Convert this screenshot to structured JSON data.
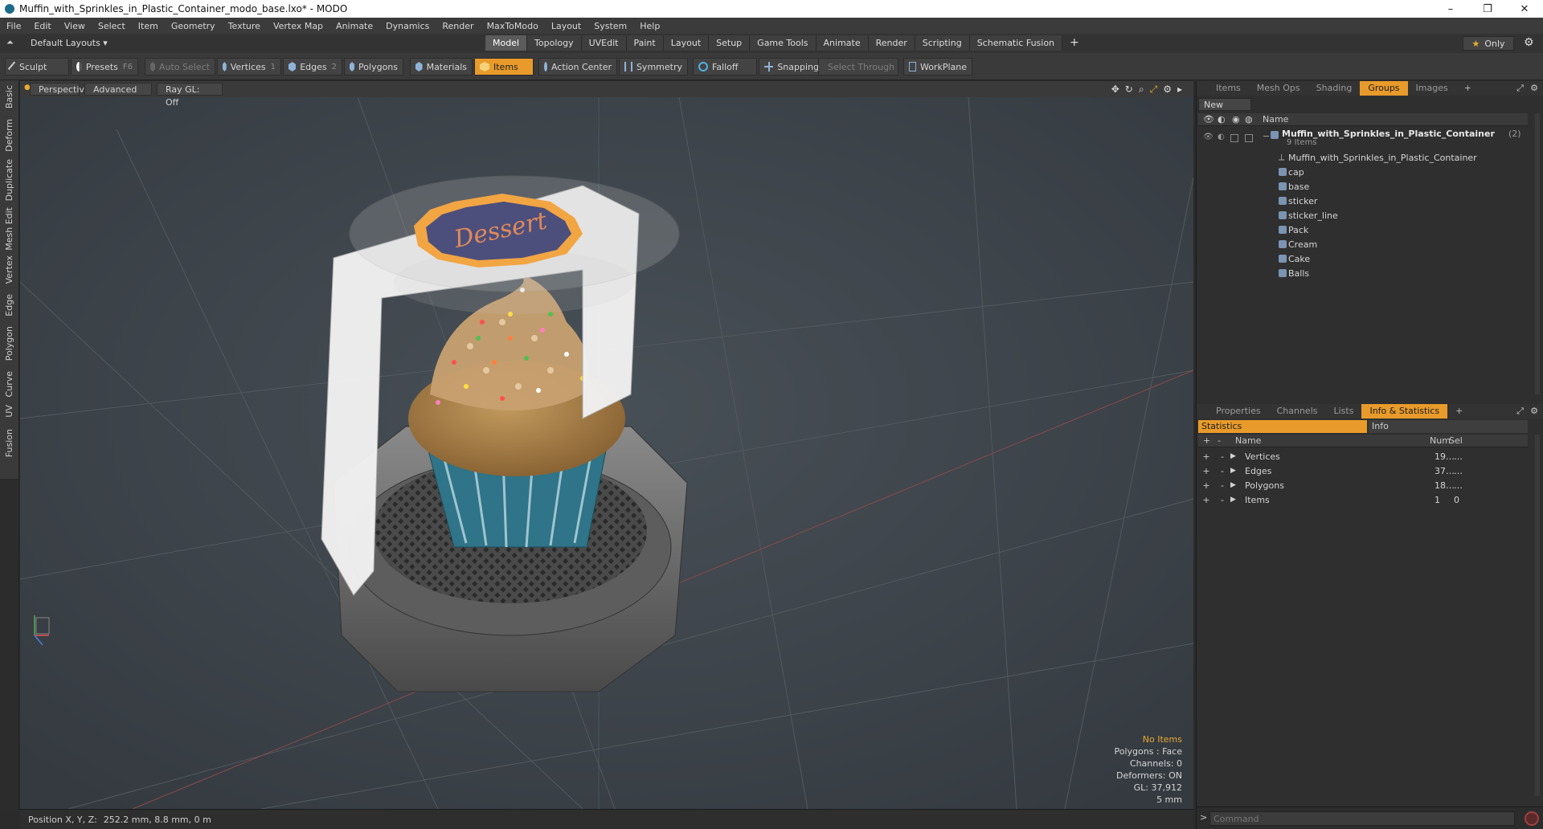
{
  "window": {
    "title": "Muffin_with_Sprinkles_in_Plastic_Container_modo_base.lxo* - MODO",
    "controls": [
      "–",
      "❐",
      "✕"
    ]
  },
  "menu": [
    "File",
    "Edit",
    "View",
    "Select",
    "Item",
    "Geometry",
    "Texture",
    "Vertex Map",
    "Animate",
    "Dynamics",
    "Render",
    "MaxToModo",
    "Layout",
    "System",
    "Help"
  ],
  "layoutbar": {
    "layout_name": "Default Layouts ▾",
    "tabs": [
      "Model",
      "Topology",
      "UVEdit",
      "Paint",
      "Layout",
      "Setup",
      "Game Tools",
      "Animate",
      "Render",
      "Scripting",
      "Schematic Fusion"
    ],
    "active_tab": "Model",
    "add": "+",
    "only_label": "Only"
  },
  "toolbar": {
    "sculpt": "Sculpt",
    "presets": "Presets",
    "presets_key": "F6",
    "auto_select": "Auto Select",
    "vertices": "Vertices",
    "vertices_num": "1",
    "edges": "Edges",
    "edges_num": "2",
    "polygons": "Polygons",
    "materials": "Materials",
    "items": "Items",
    "action_center": "Action Center",
    "symmetry": "Symmetry",
    "falloff": "Falloff",
    "snapping": "Snapping",
    "select_through": "Select Through",
    "workplane": "WorkPlane"
  },
  "left_tabs": [
    "Basic",
    "Deform",
    "Duplicate",
    "Mesh Edit",
    "Vertex",
    "Edge",
    "Polygon",
    "Curve",
    "UV",
    "Fusion"
  ],
  "viewport": {
    "perspective": "Perspective",
    "advanced": "Advanced",
    "raygl": "Ray GL: Off",
    "sticker_text": "Dessert",
    "hud": {
      "no_items": "No Items",
      "polygons": "Polygons : Face",
      "channels": "Channels: 0",
      "deformers": "Deformers: ON",
      "gl": "GL: 37,912",
      "scale": "5 mm"
    }
  },
  "status": {
    "label": "Position X, Y, Z:",
    "value": "252.2 mm, 8.8 mm, 0 m"
  },
  "items_panel": {
    "tabs": [
      "Items",
      "Mesh Ops",
      "Shading",
      "Groups",
      "Images"
    ],
    "active_tab": "Groups",
    "new_group": "New Group",
    "col_name": "Name",
    "group_name": "Muffin_with_Sprinkles_in_Plastic_Container",
    "group_count": "(2)",
    "group_sub": "9 Items",
    "items": [
      "Muffin_with_Sprinkles_in_Plastic_Container",
      "cap",
      "base",
      "sticker",
      "sticker_line",
      "Pack",
      "Cream",
      "Cake",
      "Balls"
    ]
  },
  "stats_panel": {
    "tabs": [
      "Properties",
      "Channels",
      "Lists",
      "Info & Statistics"
    ],
    "active_tab": "Info & Statistics",
    "sub_tabs": [
      "Statistics",
      "Info"
    ],
    "cols": [
      "Name",
      "Num",
      "Sel"
    ],
    "rows": [
      {
        "name": "Vertices",
        "num": "19…",
        "sel": "…"
      },
      {
        "name": "Edges",
        "num": "37…",
        "sel": "…"
      },
      {
        "name": "Polygons",
        "num": "18…",
        "sel": "…"
      },
      {
        "name": "Items",
        "num": "1",
        "sel": "0"
      }
    ]
  },
  "command": {
    "placeholder": "Command"
  },
  "colors": {
    "accent": "#e89b2a",
    "viewport_bg": "#3f464c",
    "panel_bg": "#2f2f2f"
  }
}
